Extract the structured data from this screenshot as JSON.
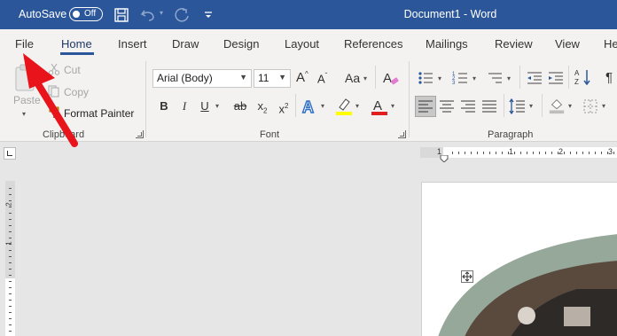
{
  "titlebar": {
    "autosave_label": "AutoSave",
    "autosave_state": "Off",
    "document_title": "Document1 - Word",
    "icons": [
      "save-icon",
      "undo-icon",
      "redo-icon",
      "customize-quick-access-icon"
    ]
  },
  "tabs": [
    {
      "label": "File",
      "active": false
    },
    {
      "label": "Home",
      "active": true
    },
    {
      "label": "Insert",
      "active": false
    },
    {
      "label": "Draw",
      "active": false
    },
    {
      "label": "Design",
      "active": false
    },
    {
      "label": "Layout",
      "active": false
    },
    {
      "label": "References",
      "active": false
    },
    {
      "label": "Mailings",
      "active": false
    },
    {
      "label": "Review",
      "active": false
    },
    {
      "label": "View",
      "active": false
    },
    {
      "label": "He",
      "active": false
    }
  ],
  "clipboard": {
    "paste_label": "Paste",
    "cut_label": "Cut",
    "copy_label": "Copy",
    "format_painter_label": "Format Painter",
    "group_label": "Clipboard"
  },
  "font": {
    "font_name": "Arial (Body)",
    "font_size": "11",
    "group_label": "Font",
    "buttons": {
      "bold": "B",
      "italic": "I",
      "underline": "U",
      "strikethrough": "ab",
      "subscript": "x",
      "superscript": "x"
    }
  },
  "paragraph": {
    "group_label": "Paragraph"
  },
  "ruler": {
    "h_numbers": [
      "1",
      "1",
      "2",
      "3"
    ],
    "v_numbers": [
      "2",
      "1"
    ]
  },
  "colors": {
    "titlebar": "#2b579a",
    "ribbon": "#f3f2f1",
    "canvas": "#e6e6e6",
    "highlight_yellow": "#ffff00",
    "font_red": "#e02020",
    "annotation_arrow": "#e8131b",
    "image_green": "#95a89a"
  }
}
